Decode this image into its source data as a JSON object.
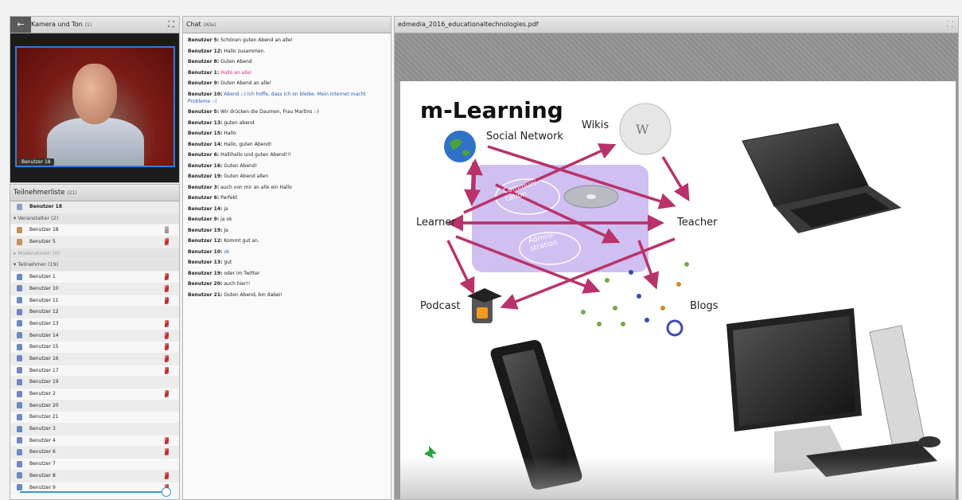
{
  "camera": {
    "title": "Kamera und Ton",
    "count": "(1)",
    "back_icon": "arrow-left-icon",
    "expand_icon": "expand-icon",
    "video_name_tag": "Benutzer 18"
  },
  "participants": {
    "title": "Teilnehmerliste",
    "count": "(21)",
    "me": "Benutzer 18",
    "groups": [
      {
        "label": "Veranstalter (2)",
        "rows": [
          {
            "name": "Benutzer 18",
            "mic": "plain"
          },
          {
            "name": "Benutzer 5",
            "mic": "muted"
          }
        ]
      },
      {
        "label": "Moderatoren (0)",
        "rows": []
      },
      {
        "label": "Teilnehmer (19)",
        "rows": [
          {
            "name": "Benutzer 1",
            "mic": "muted"
          },
          {
            "name": "Benutzer 10",
            "mic": "muted"
          },
          {
            "name": "Benutzer 11",
            "mic": "muted"
          },
          {
            "name": "Benutzer 12",
            "mic": "none"
          },
          {
            "name": "Benutzer 13",
            "mic": "muted"
          },
          {
            "name": "Benutzer 14",
            "mic": "muted"
          },
          {
            "name": "Benutzer 15",
            "mic": "muted"
          },
          {
            "name": "Benutzer 16",
            "mic": "muted"
          },
          {
            "name": "Benutzer 17",
            "mic": "muted"
          },
          {
            "name": "Benutzer 19",
            "mic": "none"
          },
          {
            "name": "Benutzer 2",
            "mic": "muted"
          },
          {
            "name": "Benutzer 20",
            "mic": "none"
          },
          {
            "name": "Benutzer 21",
            "mic": "none"
          },
          {
            "name": "Benutzer 3",
            "mic": "none"
          },
          {
            "name": "Benutzer 4",
            "mic": "muted"
          },
          {
            "name": "Benutzer 6",
            "mic": "muted"
          },
          {
            "name": "Benutzer 7",
            "mic": "none"
          },
          {
            "name": "Benutzer 8",
            "mic": "muted"
          },
          {
            "name": "Benutzer 9",
            "mic": "muted"
          }
        ]
      }
    ],
    "volume_level": 0.97
  },
  "chat": {
    "title": "Chat",
    "scope": "(Alle)",
    "messages": [
      {
        "user": "Benutzer 5:",
        "text": "Schönen guten Abend an alle!",
        "color": ""
      },
      {
        "user": "Benutzer 12:",
        "text": "Hallo zusammen.",
        "color": ""
      },
      {
        "user": "Benutzer 8:",
        "text": "Guten Abend",
        "color": ""
      },
      {
        "user": "Benutzer 1:",
        "text": "Hallo an alle!",
        "color": "pink"
      },
      {
        "user": "Benutzer 9:",
        "text": "Guten Abend an alle!",
        "color": ""
      },
      {
        "user": "Benutzer 10:",
        "text": "Abend ;-) Ich hoffe, dass ich on bleibe. Mein Internet macht Probleme :-(",
        "color": "blue"
      },
      {
        "user": "Benutzer 5:",
        "text": "Wir drücken die Daumen, Frau Martins :-)",
        "color": ""
      },
      {
        "user": "Benutzer 13:",
        "text": "guten abend",
        "color": ""
      },
      {
        "user": "Benutzer 15:",
        "text": "Hallo",
        "color": ""
      },
      {
        "user": "Benutzer 14:",
        "text": "Hallo, guten Abend!",
        "color": ""
      },
      {
        "user": "Benutzer 6:",
        "text": "Hallihallo und guten Abend!!!",
        "color": ""
      },
      {
        "user": "Benutzer 16:",
        "text": "Guten Abend!",
        "color": ""
      },
      {
        "user": "Benutzer 19:",
        "text": "Guten Abend allen",
        "color": ""
      },
      {
        "user": "Benutzer 3:",
        "text": "auch von mir an alle ein Hallo",
        "color": ""
      },
      {
        "user": "Benutzer 6:",
        "text": "Perfekt",
        "color": ""
      },
      {
        "user": "Benutzer 14:",
        "text": "ja",
        "color": ""
      },
      {
        "user": "Benutzer 9:",
        "text": "ja ok",
        "color": ""
      },
      {
        "user": "Benutzer 19:",
        "text": "Ja",
        "color": ""
      },
      {
        "user": "Benutzer 12:",
        "text": "Kommt gut an.",
        "color": ""
      },
      {
        "user": "Benutzer 10:",
        "text": "ok",
        "color": "blue"
      },
      {
        "user": "Benutzer 13:",
        "text": "gut",
        "color": ""
      },
      {
        "user": "Benutzer 19:",
        "text": "oder im Twitter",
        "color": ""
      },
      {
        "user": "Benutzer 20:",
        "text": "auch hier!!",
        "color": ""
      },
      {
        "user": "Benutzer 21:",
        "text": "Guten Abend, bin dabei!",
        "color": ""
      }
    ]
  },
  "presentation": {
    "filename": "edmedia_2016_educationaltechnologies.pdf",
    "expand_icon": "expand-icon",
    "slide": {
      "title": "m-Learning",
      "labels": {
        "social": "Social Network",
        "wikis": "Wikis",
        "learner": "Learner",
        "teacher": "Teacher",
        "podcast": "Podcast",
        "blogs": "Blogs",
        "communication": "Communi-\ncation",
        "administration": "Admini-\nstration"
      }
    }
  },
  "colors": {
    "arrow": "#b8336a",
    "accent_blue": "#2f7fd8",
    "chat_pink": "#d02b86",
    "chat_blue": "#2f58b3"
  }
}
